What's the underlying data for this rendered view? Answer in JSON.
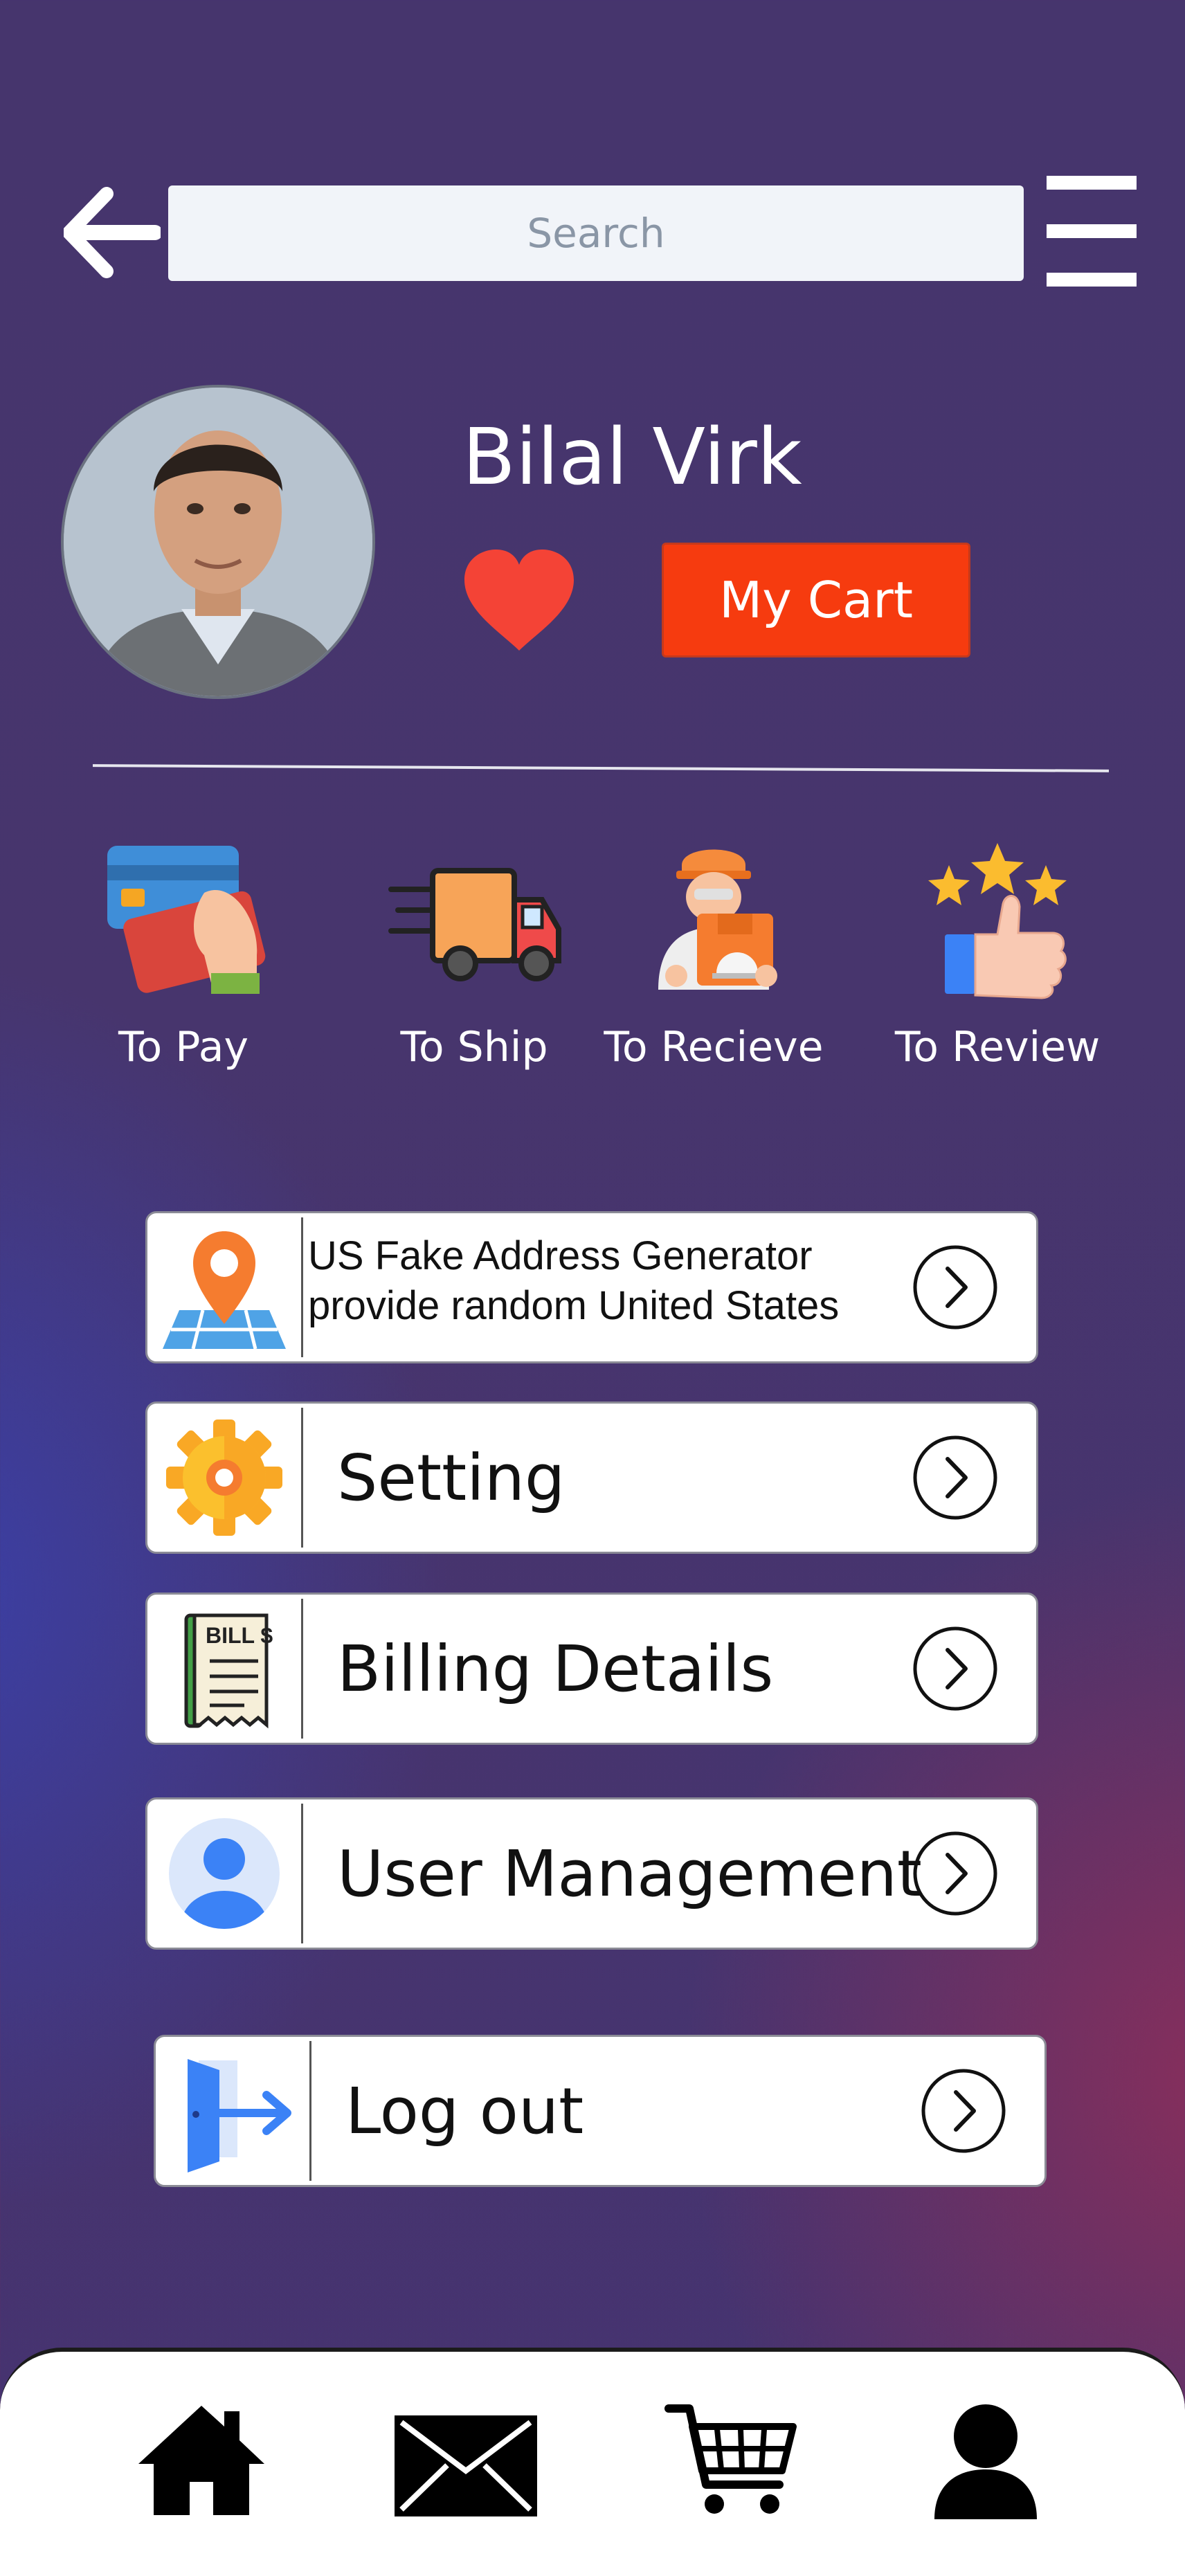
{
  "header": {
    "search_placeholder": "Search"
  },
  "profile": {
    "name": "Bilal Virk",
    "cart_label": "My Cart"
  },
  "order_status": [
    {
      "label": "To Pay",
      "icon": "credit-card-hand-icon"
    },
    {
      "label": "To Ship",
      "icon": "delivery-truck-icon"
    },
    {
      "label": "To Recieve",
      "icon": "delivery-person-icon"
    },
    {
      "label": "To Review",
      "icon": "thumbs-up-stars-icon"
    }
  ],
  "menu": [
    {
      "label": "US Fake Address Generator provide random United States",
      "icon": "map-pin-icon"
    },
    {
      "label": "Setting",
      "icon": "gear-icon"
    },
    {
      "label": "Billing Details",
      "icon": "bill-icon"
    },
    {
      "label": "User Management",
      "icon": "user-circle-icon"
    },
    {
      "label": "Log out",
      "icon": "logout-door-icon"
    }
  ],
  "bill_icon_text": "BILL $",
  "bottom_nav": [
    "home-icon",
    "mail-icon",
    "cart-icon",
    "profile-icon"
  ],
  "colors": {
    "background_top": "#46356d",
    "accent_cart": "#f63b0f",
    "heart": "#f44336"
  }
}
